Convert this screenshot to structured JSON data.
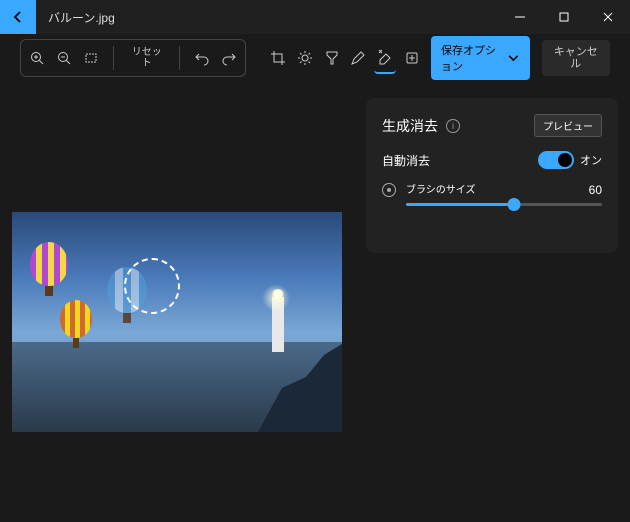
{
  "title": "バルーン.jpg",
  "toolbar": {
    "reset": "リセット",
    "save": "保存オプション",
    "cancel": "キャンセル"
  },
  "panel": {
    "title": "生成消去",
    "preview": "プレビュー",
    "auto_erase": "自動消去",
    "toggle_on": "オン",
    "brush_label": "ブラシのサイズ",
    "brush_value": "60",
    "brush_pct": 55
  }
}
